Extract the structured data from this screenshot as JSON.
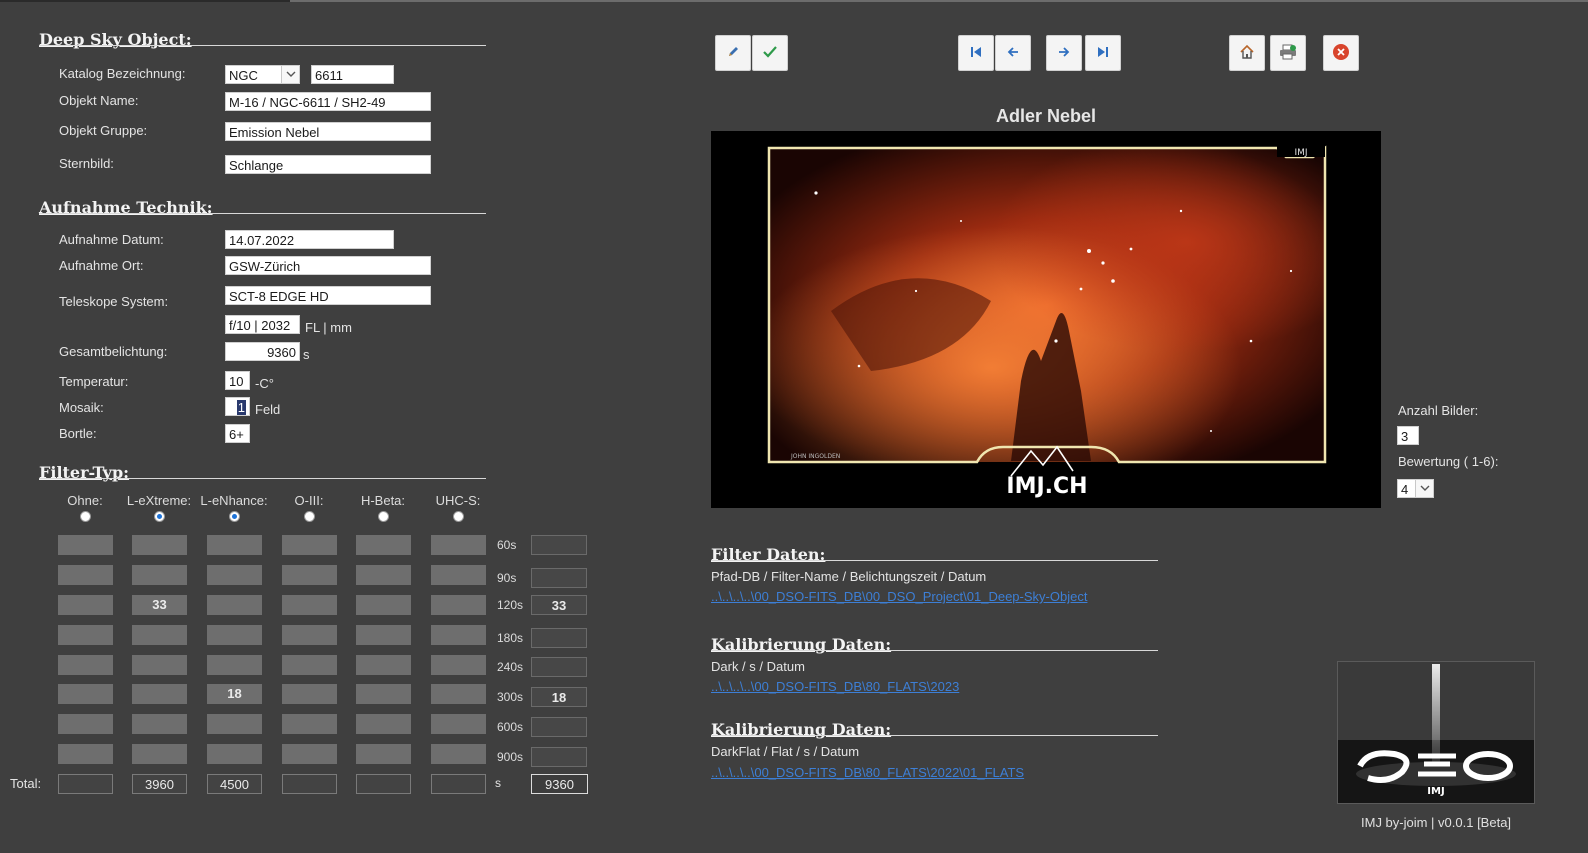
{
  "sections": {
    "dso": "Deep Sky Object:",
    "technik": "Aufnahme Technik:",
    "filter": "Filter-Typ:"
  },
  "dso": {
    "katalog_label": "Katalog Bezeichnung:",
    "katalog_value": "NGC",
    "katalog_number": "6611",
    "name_label": "Objekt Name:",
    "name_value": "M-16 / NGC-6611 / SH2-49",
    "gruppe_label": "Objekt Gruppe:",
    "gruppe_value": "Emission Nebel",
    "sternbild_label": "Sternbild:",
    "sternbild_value": "Schlange"
  },
  "technik": {
    "datum_label": "Aufnahme Datum:",
    "datum_value": "14.07.2022",
    "ort_label": "Aufnahme Ort:",
    "ort_value": "GSW-Zürich",
    "teleskop_label": "Teleskope System:",
    "teleskop_value": "SCT-8 EDGE HD",
    "focal_value": "f/10 | 2032",
    "focal_unit": "FL | mm",
    "belichtung_label": "Gesamtbelichtung:",
    "belichtung_value": "9360",
    "belichtung_unit": "s",
    "temp_label": "Temperatur:",
    "temp_value": "10",
    "temp_unit": "-C°",
    "mosaik_label": "Mosaik:",
    "mosaik_value": "1",
    "mosaik_unit": "Feld",
    "bortle_label": "Bortle:",
    "bortle_value": "6+"
  },
  "filter": {
    "headers": [
      "Ohne:",
      "L-eXtreme:",
      "L-eNhance:",
      "O-III:",
      "H-Beta:",
      "UHC-S:"
    ],
    "selected": [
      false,
      true,
      true,
      false,
      false,
      false
    ],
    "times": [
      "60s",
      "90s",
      "120s",
      "180s",
      "240s",
      "300s",
      "600s",
      "900s"
    ],
    "rows": [
      [
        "",
        "",
        "",
        "",
        "",
        "",
        ""
      ],
      [
        "",
        "",
        "",
        "",
        "",
        "",
        ""
      ],
      [
        "",
        "33",
        "",
        "",
        "",
        "",
        "33"
      ],
      [
        "",
        "",
        "",
        "",
        "",
        "",
        ""
      ],
      [
        "",
        "",
        "",
        "",
        "",
        "",
        ""
      ],
      [
        "",
        "",
        "18",
        "",
        "",
        "",
        "18"
      ],
      [
        "",
        "",
        "",
        "",
        "",
        "",
        ""
      ],
      [
        "",
        "",
        "",
        "",
        "",
        "",
        ""
      ]
    ],
    "total_label": "Total:",
    "totals": [
      "",
      "3960",
      "4500",
      "",
      "",
      ""
    ],
    "total_unit": "s",
    "grand_total": "9360"
  },
  "toolbar": {
    "edit": "pencil-icon",
    "save": "check-icon",
    "first": "first-record-icon",
    "prev": "arrow-left-icon",
    "next": "arrow-right-icon",
    "last": "last-record-icon",
    "home": "home-icon",
    "print": "print-icon",
    "close": "close-icon"
  },
  "picture": {
    "title": "Adler Nebel",
    "watermark": "IMJ.CH"
  },
  "side": {
    "anzahl_label": "Anzahl Bilder:",
    "anzahl_value": "3",
    "bewertung_label": "Bewertung ( 1-6):",
    "bewertung_value": "4"
  },
  "filter_daten": {
    "title": "Filter Daten:",
    "desc": "Pfad-DB / Filter-Name / Belichtungszeit / Datum",
    "link": "..\\..\\..\\..\\00_DSO-FITS_DB\\00_DSO_Project\\01_Deep-Sky-Object"
  },
  "kalib1": {
    "title": "Kalibrierung Daten:",
    "desc": "Dark / s / Datum",
    "link": "..\\..\\..\\..\\00_DSO-FITS_DB\\80_FLATS\\2023"
  },
  "kalib2": {
    "title": "Kalibrierung Daten:",
    "desc": "DarkFlat / Flat / s / Datum",
    "link": "..\\..\\..\\..\\00_DSO-FITS_DB\\80_FLATS\\2022\\01_FLATS"
  },
  "footer": "IMJ by-joim | v0.0.1 [Beta]",
  "colors": {
    "background": "#3f3f3f",
    "link": "#3d7fd6",
    "radio_selected": "#1e73d8",
    "close_button": "#d8442c",
    "check": "#2e9a4a"
  }
}
